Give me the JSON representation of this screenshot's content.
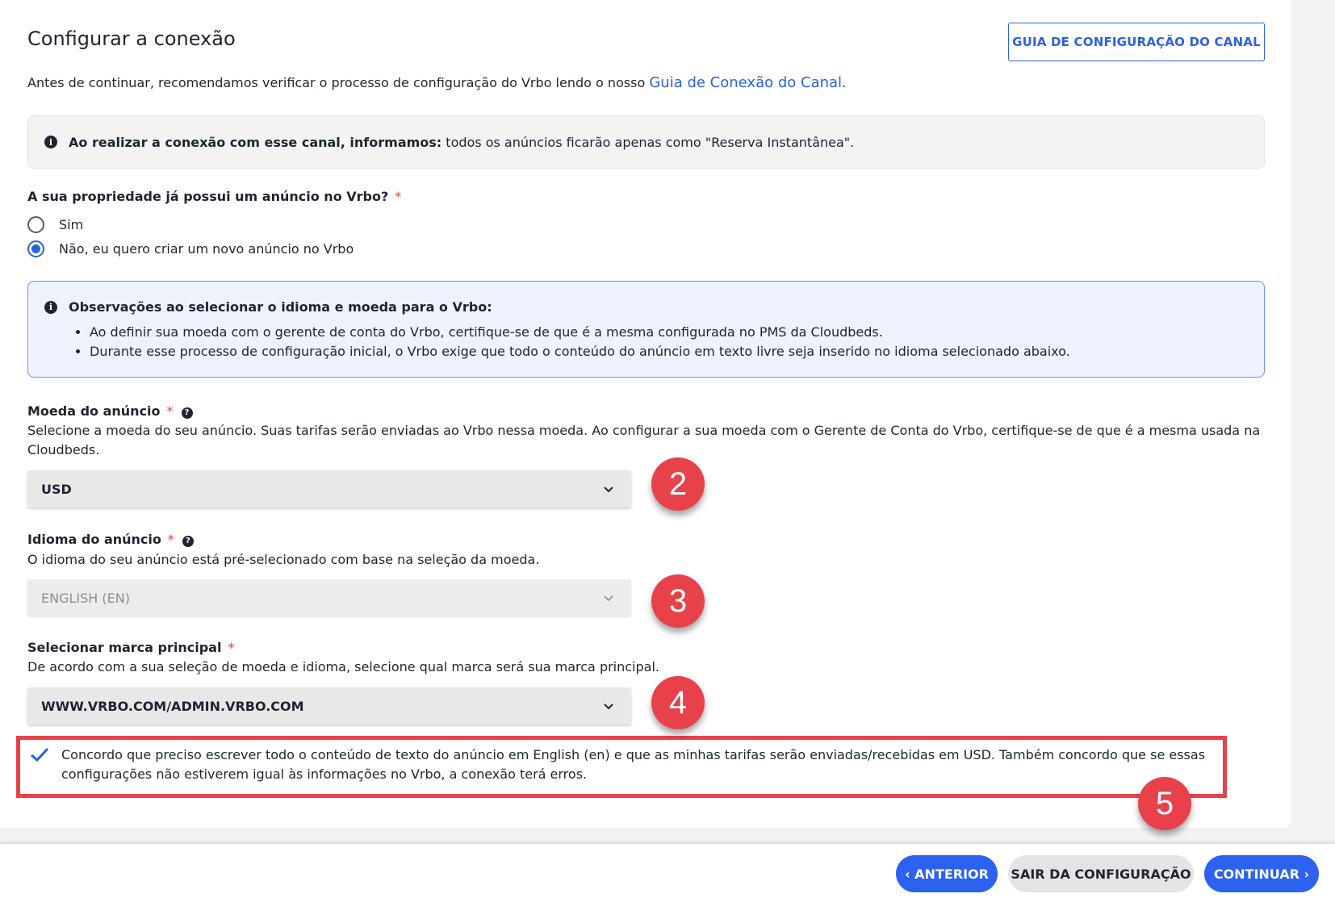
{
  "header": {
    "title": "Configurar a conexão",
    "guide_button": "GUIA DE CONFIGURAÇÃO DO CANAL",
    "intro_text": "Antes de continuar, recomendamos verificar o processo de configuração do Vrbo lendo o nosso ",
    "intro_link": "Guia de Conexão do Canal",
    "intro_end": "."
  },
  "notice": {
    "bold": "Ao realizar a conexão com esse canal, informamos:",
    "text": " todos os anúncios ficarão apenas como \"Reserva Instantânea\"."
  },
  "question": {
    "label": "A sua propriedade já possui um anúncio no Vrbo?",
    "required": "*",
    "options": [
      {
        "label": "Sim",
        "selected": false
      },
      {
        "label": "Não, eu quero criar um novo anúncio no Vrbo",
        "selected": true
      }
    ]
  },
  "observations": {
    "title": "Observações ao selecionar o idioma e moeda para o Vrbo:",
    "items": [
      "Ao definir sua moeda com o gerente de conta do Vrbo, certifique-se de que é a mesma configurada no PMS da Cloudbeds.",
      "Durante esse processo de configuração inicial, o Vrbo exige que todo o conteúdo do anúncio em texto livre seja inserido no idioma selecionado abaixo."
    ]
  },
  "currency": {
    "label": "Moeda do anúncio",
    "required": "*",
    "description": "Selecione a moeda do seu anúncio. Suas tarifas serão enviadas ao Vrbo nessa moeda. Ao configurar a sua moeda com o Gerente de Conta do Vrbo, certifique-se de que é a mesma usada na Cloudbeds.",
    "value": "USD"
  },
  "language": {
    "label": "Idioma do anúncio",
    "required": "*",
    "description": "O idioma do seu anúncio está pré-selecionado com base na seleção da moeda.",
    "value": "ENGLISH (EN)"
  },
  "brand": {
    "label": "Selecionar marca principal",
    "required": "*",
    "description": "De acordo com a sua seleção de moeda e idioma, selecione qual marca será sua marca principal.",
    "value": "WWW.VRBO.COM/ADMIN.VRBO.COM"
  },
  "agreement": {
    "checked": true,
    "text": "Concordo que preciso escrever todo o conteúdo de texto do anúncio em English (en) e que as minhas tarifas serão enviadas/recebidas em USD. Também concordo que se essas configurações não estiverem igual às informações no Vrbo, a conexão terá erros."
  },
  "badges": [
    "2",
    "3",
    "4",
    "5"
  ],
  "footer": {
    "back": "‹ ANTERIOR",
    "exit": "SAIR DA CONFIGURAÇÃO",
    "continue": "CONTINUAR ›"
  },
  "colors": {
    "accent": "#2b62dc",
    "badge": "#e8414a",
    "required": "#e0413d"
  }
}
